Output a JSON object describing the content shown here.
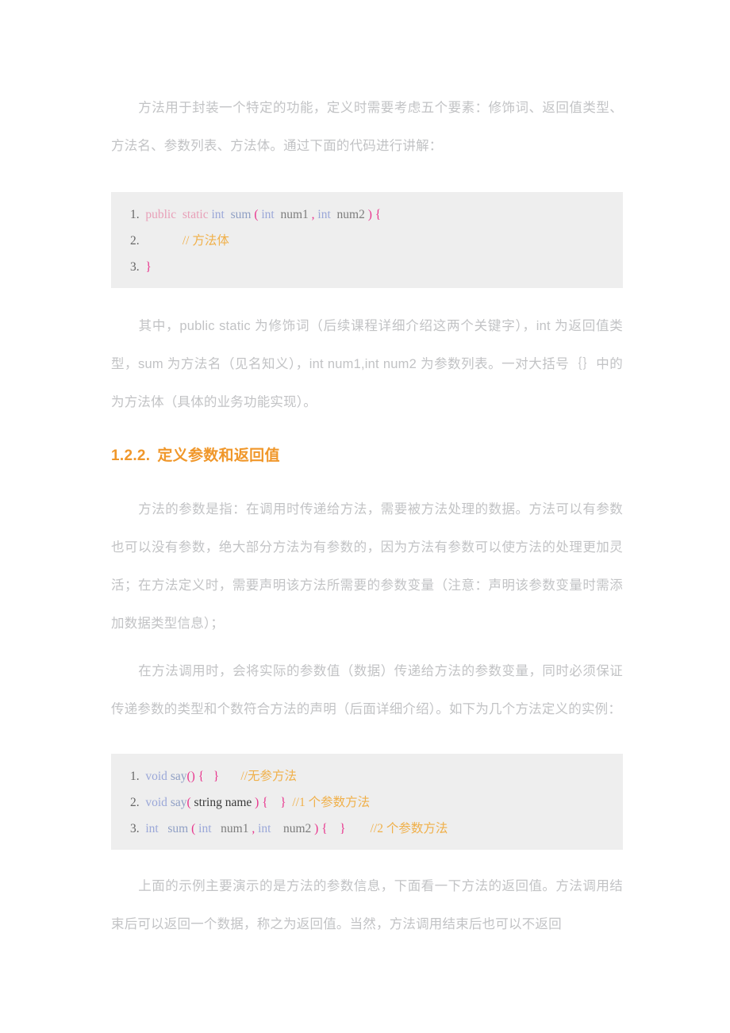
{
  "document": {
    "paragraphs": {
      "p1": "方法用于封装一个特定的功能，定义时需要考虑五个要素：修饰词、返回值类型、方法名、参数列表、方法体。通过下面的代码进行讲解：",
      "p2": "其中，public static 为修饰词（后续课程详细介绍这两个关键字），int 为返回值类型，sum 为方法名（见名知义），int num1,int num2 为参数列表。一对大括号｛｝中的为方法体（具体的业务功能实现）。",
      "p3": "方法的参数是指：在调用时传递给方法，需要被方法处理的数据。方法可以有参数也可以没有参数，绝大部分方法为有参数的，因为方法有参数可以使方法的处理更加灵活；在方法定义时，需要声明该方法所需要的参数变量（注意：声明该参数变量时需添加数据类型信息）；",
      "p4": "在方法调用时，会将实际的参数值（数据）传递给方法的参数变量，同时必须保证传递参数的类型和个数符合方法的声明（后面详细介绍）。如下为几个方法定义的实例：",
      "p5": "上面的示例主要演示的是方法的参数信息，下面看一下方法的返回值。方法调用结束后可以返回一个数据，称之为返回值。当然，方法调用结束后也可以不返回"
    },
    "heading": {
      "number": "1.2.2.",
      "title": "定义参数和返回值",
      "color": "#f0972a"
    },
    "code_block_1": {
      "lines": [
        {
          "number": "1.",
          "tokens": [
            {
              "text": "public",
              "type": "keyword"
            },
            {
              "text": "  ",
              "type": "space"
            },
            {
              "text": "static",
              "type": "keyword"
            },
            {
              "text": " ",
              "type": "space"
            },
            {
              "text": "int",
              "type": "type"
            },
            {
              "text": "  ",
              "type": "space"
            },
            {
              "text": "sum",
              "type": "function"
            },
            {
              "text": " ",
              "type": "space"
            },
            {
              "text": "(",
              "type": "punct"
            },
            {
              "text": " ",
              "type": "space"
            },
            {
              "text": "int",
              "type": "type"
            },
            {
              "text": "  ",
              "type": "space"
            },
            {
              "text": "num1",
              "type": "var"
            },
            {
              "text": " ",
              "type": "space"
            },
            {
              "text": ",",
              "type": "punct"
            },
            {
              "text": " ",
              "type": "space"
            },
            {
              "text": "int",
              "type": "type"
            },
            {
              "text": "  ",
              "type": "space"
            },
            {
              "text": "num2",
              "type": "var"
            },
            {
              "text": " ",
              "type": "space"
            },
            {
              "text": ")",
              "type": "punct"
            },
            {
              "text": " ",
              "type": "space"
            },
            {
              "text": "{",
              "type": "punct"
            }
          ]
        },
        {
          "number": "2.",
          "tokens": [
            {
              "text": "            ",
              "type": "space"
            },
            {
              "text": "// 方法体",
              "type": "comment"
            }
          ]
        },
        {
          "number": "3.",
          "tokens": [
            {
              "text": "}",
              "type": "punct"
            }
          ]
        }
      ]
    },
    "code_block_2": {
      "lines": [
        {
          "number": "1.",
          "tokens": [
            {
              "text": "void",
              "type": "type"
            },
            {
              "text": " ",
              "type": "space"
            },
            {
              "text": "say",
              "type": "function"
            },
            {
              "text": "()",
              "type": "punct"
            },
            {
              "text": " ",
              "type": "space"
            },
            {
              "text": "{",
              "type": "punct"
            },
            {
              "text": "   ",
              "type": "space"
            },
            {
              "text": "}",
              "type": "punct"
            },
            {
              "text": "       ",
              "type": "space"
            },
            {
              "text": "//无参方法",
              "type": "comment"
            }
          ]
        },
        {
          "number": "2.",
          "tokens": [
            {
              "text": "void",
              "type": "type"
            },
            {
              "text": " ",
              "type": "space"
            },
            {
              "text": "say",
              "type": "function"
            },
            {
              "text": "(",
              "type": "punct"
            },
            {
              "text": " string name ",
              "type": "plain"
            },
            {
              "text": ")",
              "type": "punct"
            },
            {
              "text": " ",
              "type": "space"
            },
            {
              "text": "{",
              "type": "punct"
            },
            {
              "text": "    ",
              "type": "space"
            },
            {
              "text": "}",
              "type": "punct"
            },
            {
              "text": "  ",
              "type": "space"
            },
            {
              "text": "//1 个参数方法",
              "type": "comment"
            }
          ]
        },
        {
          "number": "3.",
          "tokens": [
            {
              "text": "int",
              "type": "type"
            },
            {
              "text": "   ",
              "type": "space"
            },
            {
              "text": "sum",
              "type": "function"
            },
            {
              "text": " ",
              "type": "space"
            },
            {
              "text": "(",
              "type": "punct"
            },
            {
              "text": " ",
              "type": "space"
            },
            {
              "text": "int",
              "type": "type"
            },
            {
              "text": "   ",
              "type": "space"
            },
            {
              "text": "num1",
              "type": "var"
            },
            {
              "text": " ",
              "type": "space"
            },
            {
              "text": ",",
              "type": "punct"
            },
            {
              "text": " ",
              "type": "space"
            },
            {
              "text": "int",
              "type": "type"
            },
            {
              "text": "    ",
              "type": "space"
            },
            {
              "text": "num2",
              "type": "var"
            },
            {
              "text": " ",
              "type": "space"
            },
            {
              "text": ")",
              "type": "punct"
            },
            {
              "text": " ",
              "type": "space"
            },
            {
              "text": "{",
              "type": "punct"
            },
            {
              "text": "    ",
              "type": "space"
            },
            {
              "text": "}",
              "type": "punct"
            },
            {
              "text": "        ",
              "type": "space"
            },
            {
              "text": "//2 个参数方法",
              "type": "comment"
            }
          ]
        }
      ]
    },
    "theme": {
      "text_color": "#c2c3c5",
      "code_bg": "#eeeeee",
      "accent": "#f0972a",
      "punct_color": "#e8338c",
      "comment_color": "#f0b04a",
      "type_color": "#9aa7d8",
      "keyword_color": "#e8a0b8"
    }
  }
}
